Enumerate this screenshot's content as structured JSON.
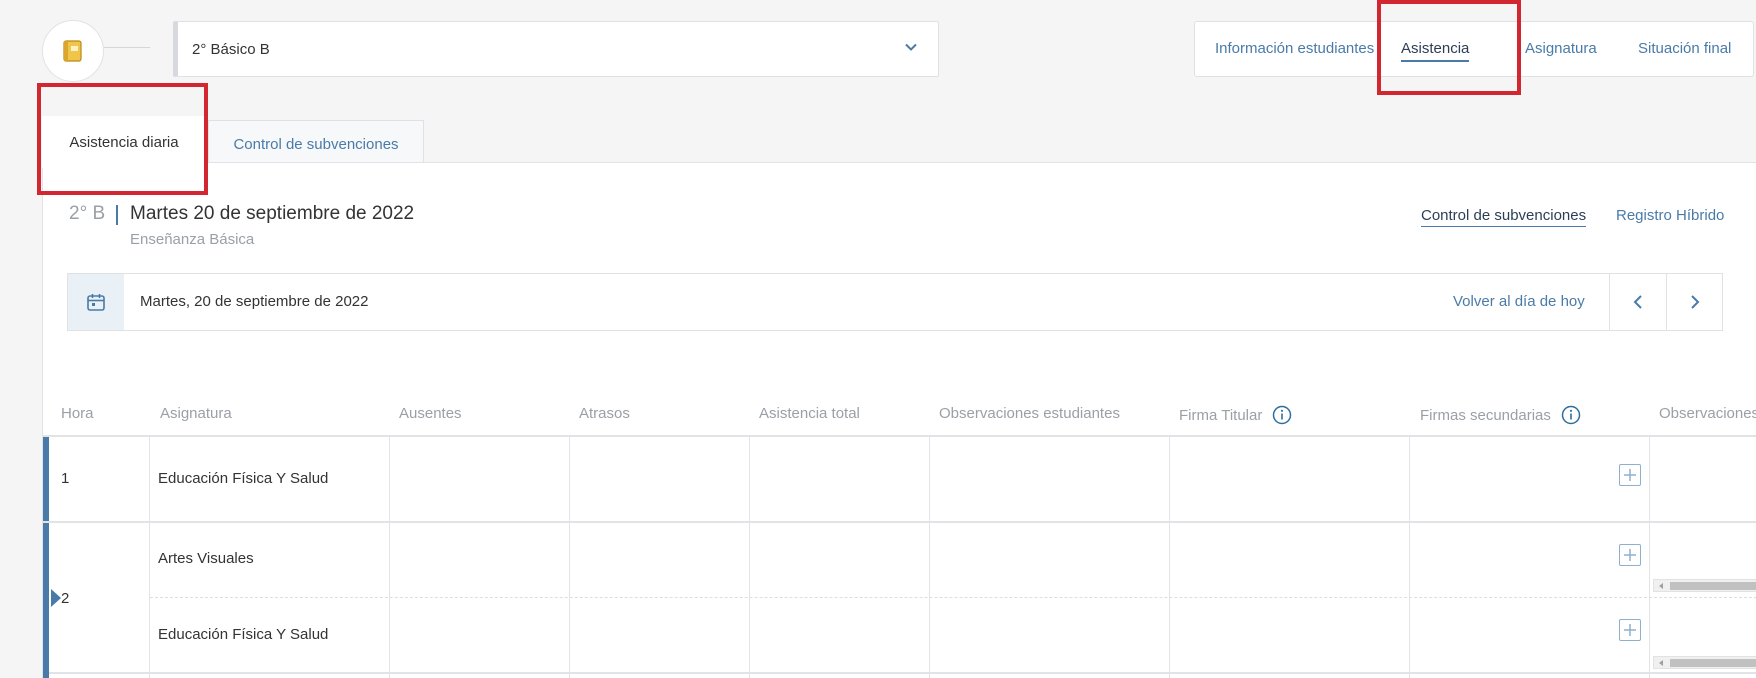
{
  "colors": {
    "accent": "#4a7ba8",
    "highlight": "#d22630",
    "row_marker": "#4a7ba8"
  },
  "course_selector": {
    "icon": "book-icon",
    "value": "2° Básico B"
  },
  "top_tabs": [
    {
      "label": "Información estudiantes",
      "active": false
    },
    {
      "label": "Asistencia",
      "active": true
    },
    {
      "label": "Asignatura",
      "active": false
    },
    {
      "label": "Situación final",
      "active": false
    }
  ],
  "sub_tabs": [
    {
      "label": "Asistencia diaria",
      "active": true
    },
    {
      "label": "Control de subvenciones",
      "active": false
    }
  ],
  "header": {
    "grade": "2° B",
    "date_title": "Martes 20 de septiembre de 2022",
    "level": "Enseñanza Básica",
    "links": [
      "Control de subvenciones",
      "Registro Híbrido"
    ]
  },
  "date_nav": {
    "icon": "calendar-icon",
    "date_text": "Martes, 20 de septiembre de 2022",
    "today_label": "Volver al día de hoy"
  },
  "table": {
    "columns": [
      "Hora",
      "Asignatura",
      "Ausentes",
      "Atrasos",
      "Asistencia total",
      "Observaciones estudiantes",
      "Firma Titular",
      "Firmas secundarias",
      "Observaciones"
    ],
    "rows": [
      {
        "hora": "1",
        "subjects": [
          "Educación Física Y Salud"
        ]
      },
      {
        "hora": "2",
        "subjects": [
          "Artes Visuales",
          "Educación Física Y Salud"
        ]
      }
    ]
  }
}
